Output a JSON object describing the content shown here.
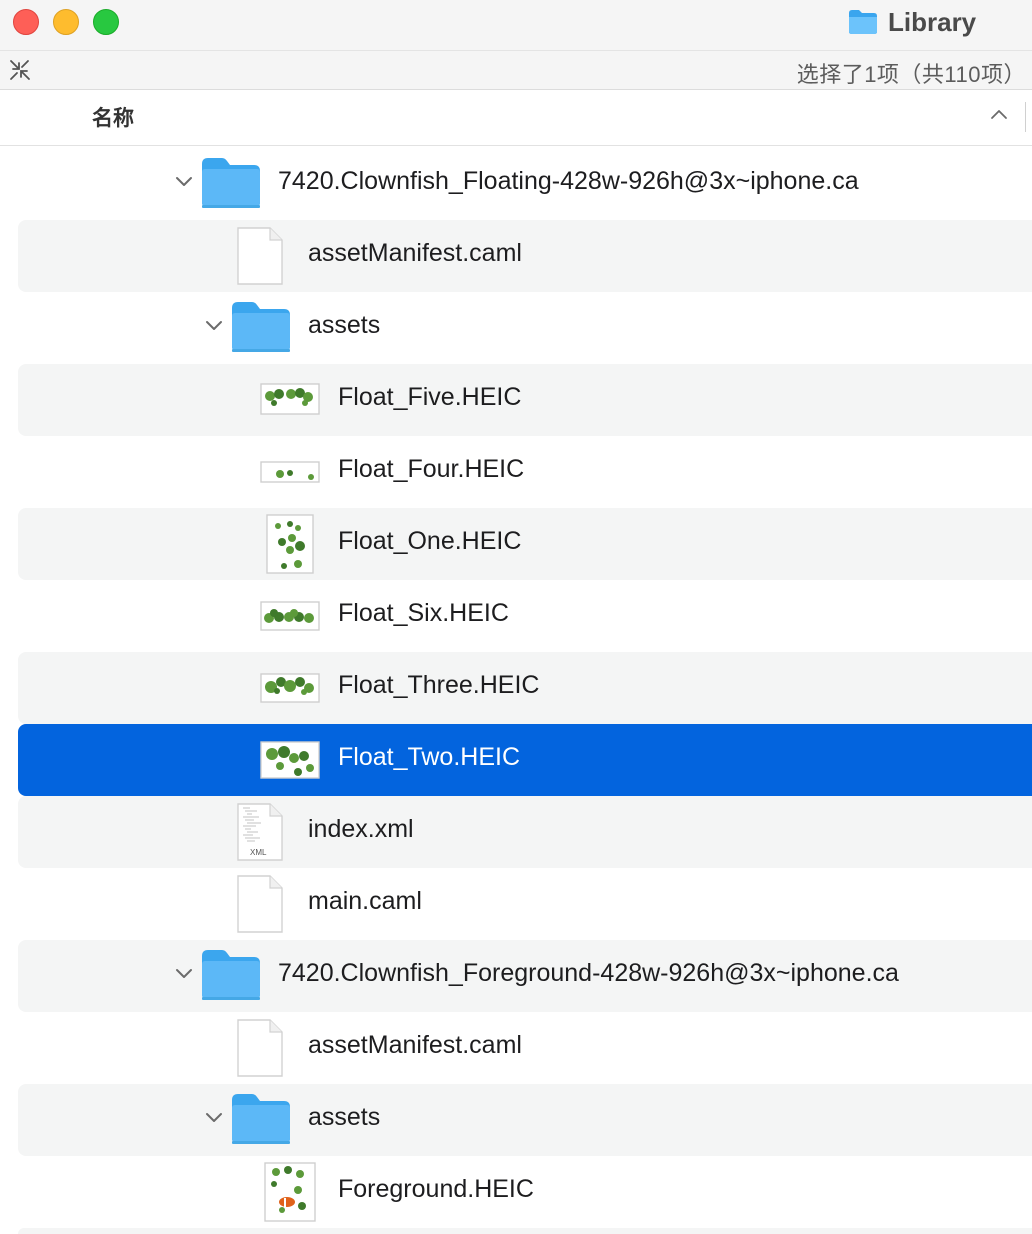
{
  "window": {
    "title": "Library",
    "status": "选择了1项（共110项）"
  },
  "columns": {
    "name": "名称"
  },
  "rows": [
    {
      "label": "7420.Clownfish_Floating-428w-926h@3x~iphone.ca",
      "kind": "folder",
      "level": 0,
      "expanded": true,
      "selected": false
    },
    {
      "label": "assetManifest.caml",
      "kind": "document",
      "level": 1,
      "selected": false
    },
    {
      "label": "assets",
      "kind": "folder",
      "level": 1,
      "expanded": true,
      "selected": false
    },
    {
      "label": "Float_Five.HEIC",
      "kind": "image-thumbnail",
      "level": 2,
      "selected": false
    },
    {
      "label": "Float_Four.HEIC",
      "kind": "image-thumbnail",
      "level": 2,
      "selected": false
    },
    {
      "label": "Float_One.HEIC",
      "kind": "image-thumbnail",
      "level": 2,
      "selected": false
    },
    {
      "label": "Float_Six.HEIC",
      "kind": "image-thumbnail",
      "level": 2,
      "selected": false
    },
    {
      "label": "Float_Three.HEIC",
      "kind": "image-thumbnail",
      "level": 2,
      "selected": false
    },
    {
      "label": "Float_Two.HEIC",
      "kind": "image-thumbnail",
      "level": 2,
      "selected": true
    },
    {
      "label": "index.xml",
      "kind": "xml-document",
      "icon_text": "XML",
      "level": 1,
      "selected": false
    },
    {
      "label": "main.caml",
      "kind": "document",
      "level": 1,
      "selected": false
    },
    {
      "label": "7420.Clownfish_Foreground-428w-926h@3x~iphone.ca",
      "kind": "folder",
      "level": 0,
      "expanded": true,
      "selected": false
    },
    {
      "label": "assetManifest.caml",
      "kind": "document",
      "level": 1,
      "selected": false
    },
    {
      "label": "assets",
      "kind": "folder",
      "level": 1,
      "expanded": true,
      "selected": false
    },
    {
      "label": "Foreground.HEIC",
      "kind": "image-thumbnail",
      "level": 2,
      "selected": false
    }
  ],
  "colors": {
    "selection": "#0364de",
    "folder": "#5cb8f7",
    "alt_row": "#f4f5f5",
    "close": "#fe5f57",
    "minimize": "#febc2e",
    "zoom": "#28c840"
  }
}
